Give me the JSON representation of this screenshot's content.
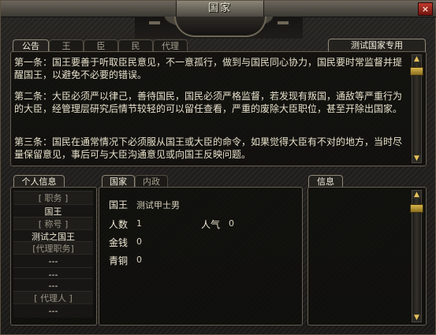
{
  "window": {
    "title": "国家",
    "close_glyph": "×",
    "close_icon": "close-icon"
  },
  "top_tabs": [
    {
      "label": "公告",
      "active": true
    },
    {
      "label": "王",
      "active": false
    },
    {
      "label": "臣",
      "active": false
    },
    {
      "label": "民",
      "active": false
    },
    {
      "label": "代理",
      "active": false
    }
  ],
  "country_name": "测试国家专用",
  "laws": [
    "第一条：国王要善于听取臣民意见，不一意孤行，做到与国民同心协力，国民要时常监督并提醒国王，以避免不必要的错误。",
    "第二条：大臣必须严以律己，善待国民，国民必须严格监督，若发现有叛国，通敌等严重行为的大臣，经管理层研究后情节较轻的可以留任查看，严重的废除大臣职位，甚至开除出国家。",
    "第三条：国民在通常情况下必须服从国王或大臣的命令，如果觉得大臣有不对的地方，当时尽量保留意见，事后可与大臣沟通意见或向国王反映问题。"
  ],
  "personal_info": {
    "title": "个人信息",
    "rows": [
      {
        "label": "[    职务    ]",
        "value": "国王"
      },
      {
        "label": "[    称号    ]",
        "value": "测试之国王"
      },
      {
        "label": "[代理职务]",
        "value": "---"
      },
      {
        "extra_values": [
          "---",
          "---"
        ]
      },
      {
        "label": "[   代理人   ]",
        "value": "---"
      }
    ],
    "labels": [
      "[    职务    ]",
      "[    称号    ]",
      "[代理职务]",
      "[   代理人   ]"
    ],
    "values": [
      "国王",
      "测试之国王",
      "---",
      "---",
      "---",
      "---"
    ]
  },
  "country_panel": {
    "tabs": [
      {
        "label": "国家",
        "active": true
      },
      {
        "label": "内政",
        "active": false
      }
    ],
    "king_label": "国王",
    "king_value": "测试甲士男",
    "population_label": "人数",
    "population_value": "1",
    "popularity_label": "人气",
    "popularity_value": "0",
    "gold_label": "金钱",
    "gold_value": "0",
    "bronze_label": "青铜",
    "bronze_value": "0"
  },
  "info_panel": {
    "title": "信息"
  },
  "colors": {
    "accent_gold": "#e6c15a",
    "text": "#e7e0ca",
    "close_red": "#c23a2e"
  }
}
